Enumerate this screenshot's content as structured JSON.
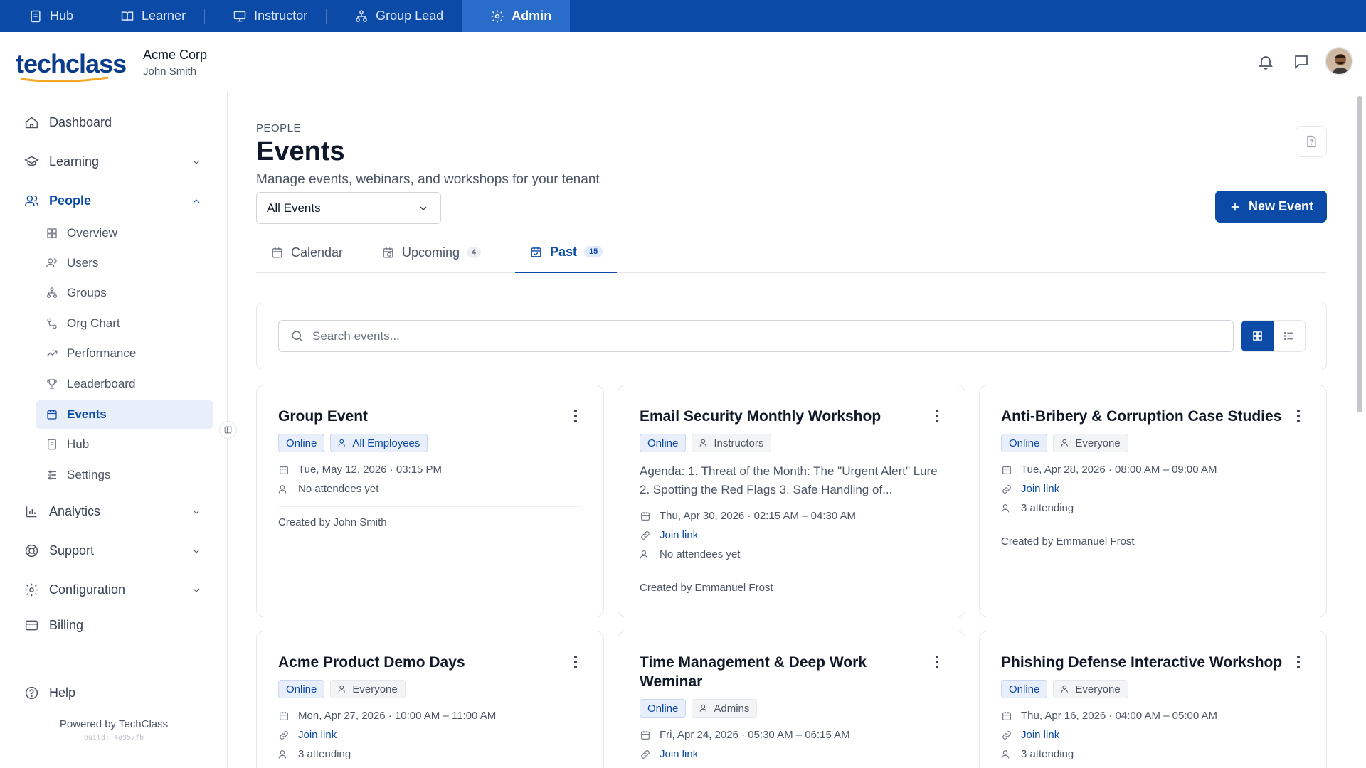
{
  "roles": [
    {
      "label": "Hub",
      "icon": "book-icon",
      "active": false
    },
    {
      "label": "Learner",
      "icon": "open-book-icon",
      "active": false
    },
    {
      "label": "Instructor",
      "icon": "presentation-icon",
      "active": false
    },
    {
      "label": "Group Lead",
      "icon": "hierarchy-icon",
      "active": false
    },
    {
      "label": "Admin",
      "icon": "gear-icon",
      "active": true
    }
  ],
  "header": {
    "logo": "techclass",
    "tenant": "Acme Corp",
    "user": "John Smith"
  },
  "sidebar": {
    "items": [
      {
        "label": "Dashboard"
      },
      {
        "label": "Learning"
      },
      {
        "label": "People"
      },
      {
        "label": "Analytics"
      },
      {
        "label": "Support"
      },
      {
        "label": "Configuration"
      },
      {
        "label": "Billing"
      },
      {
        "label": "Help"
      }
    ],
    "people_sub": [
      {
        "label": "Overview"
      },
      {
        "label": "Users"
      },
      {
        "label": "Groups"
      },
      {
        "label": "Org Chart"
      },
      {
        "label": "Performance"
      },
      {
        "label": "Leaderboard"
      },
      {
        "label": "Events"
      },
      {
        "label": "Hub"
      },
      {
        "label": "Settings"
      }
    ],
    "powered": "Powered by TechClass",
    "build": "build: 4a957fb"
  },
  "page": {
    "breadcrumb": "PEOPLE",
    "title": "Events",
    "subtitle": "Manage events, webinars, and workshops for your tenant",
    "filter_value": "All Events",
    "new_button": "New Event",
    "search_placeholder": "Search events..."
  },
  "tabs": [
    {
      "label": "Calendar",
      "count": ""
    },
    {
      "label": "Upcoming",
      "count": "4"
    },
    {
      "label": "Past",
      "count": "15"
    }
  ],
  "colors": {
    "primary": "#0b4aa6",
    "rolebar": "#0b4aa6",
    "active_role": "#2a6cc9"
  },
  "events": [
    {
      "title": "Group Event",
      "type": "Online",
      "audience": "All Employees",
      "date": "Tue, May 12, 2026 · 03:15 PM",
      "attendees": "No attendees yet",
      "creator": "Created by John Smith"
    },
    {
      "title": "Email Security Monthly Workshop",
      "type": "Online",
      "audience": "Instructors",
      "agenda": "Agenda: 1. Threat of the Month: The \"Urgent Alert\" Lure 2. Spotting the Red Flags 3. Safe Handling of...",
      "date": "Thu, Apr 30, 2026 · 02:15 AM – 04:30 AM",
      "link": "Join link",
      "attendees": "No attendees yet",
      "creator": "Created by Emmanuel Frost"
    },
    {
      "title": "Anti-Bribery & Corruption Case Studies",
      "type": "Online",
      "audience": "Everyone",
      "date": "Tue, Apr 28, 2026 · 08:00 AM – 09:00 AM",
      "link": "Join link",
      "attendees": "3 attending",
      "creator": "Created by Emmanuel Frost"
    },
    {
      "title": "Acme Product Demo Days",
      "type": "Online",
      "audience": "Everyone",
      "date": "Mon, Apr 27, 2026 · 10:00 AM – 11:00 AM",
      "link": "Join link",
      "attendees": "3 attending"
    },
    {
      "title": "Time Management & Deep Work Weminar",
      "type": "Online",
      "audience": "Admins",
      "date": "Fri, Apr 24, 2026 · 05:30 AM – 06:15 AM",
      "link": "Join link"
    },
    {
      "title": "Phishing Defense Interactive Workshop",
      "type": "Online",
      "audience": "Everyone",
      "date": "Thu, Apr 16, 2026 · 04:00 AM – 05:00 AM",
      "link": "Join link",
      "attendees": "3 attending"
    }
  ]
}
